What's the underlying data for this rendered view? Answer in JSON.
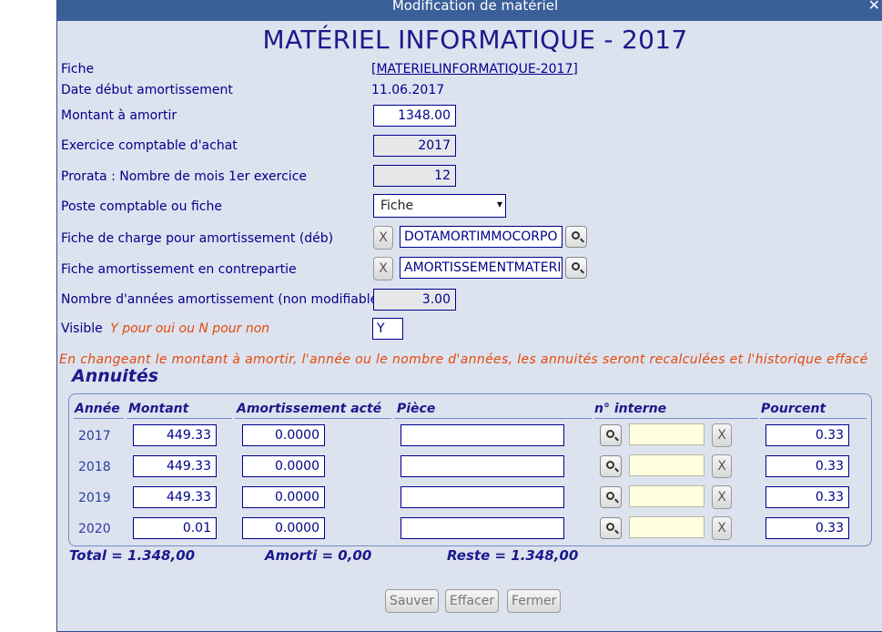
{
  "dialog": {
    "window_title": "Modification de matériel",
    "close_glyph": "✕",
    "heading": "MATÉRIEL INFORMATIQUE - 2017"
  },
  "form": {
    "fiche": {
      "label": "Fiche",
      "value": "[MATERIELINFORMATIQUE-2017]"
    },
    "date_debut": {
      "label": "Date début amortissement",
      "value": "11.06.2017"
    },
    "montant": {
      "label": "Montant à amortir",
      "value": "1348.00"
    },
    "exercice": {
      "label": "Exercice comptable d'achat",
      "value": "2017"
    },
    "prorata": {
      "label": "Prorata : Nombre de mois 1er exercice",
      "value": "12"
    },
    "poste": {
      "label": "Poste comptable ou fiche",
      "value": "Fiche"
    },
    "fiche_charge": {
      "label": "Fiche de charge pour amortissement (déb)",
      "value": "DOTAMORTIMMOCORPO",
      "clear_label": "X"
    },
    "fiche_contrepartie": {
      "label": "Fiche amortissement en contrepartie",
      "value": "AMORTISSEMENTMATERIEL",
      "clear_label": "X"
    },
    "nb_annees": {
      "label": "Nombre d'années amortissement (non modifiable)",
      "value": "3.00"
    },
    "visible": {
      "label": "Visible",
      "hint": "Y pour oui ou N pour non",
      "value": "Y"
    }
  },
  "warning": "En changeant le montant à amortir, l'année ou le nombre d'années, les annuités seront recalculées et l'historique effacé",
  "annuites": {
    "title": "Annuités",
    "headers": {
      "annee": "Année",
      "montant": "Montant",
      "amort": "Amortissement acté",
      "piece": "Pièce",
      "interne": "n° interne",
      "pourcent": "Pourcent"
    },
    "rows": [
      {
        "annee": "2017",
        "montant": "449.33",
        "amort": "0.0000",
        "piece": "",
        "pourcent": "0.33",
        "clear_label": "X"
      },
      {
        "annee": "2018",
        "montant": "449.33",
        "amort": "0.0000",
        "piece": "",
        "pourcent": "0.33",
        "clear_label": "X"
      },
      {
        "annee": "2019",
        "montant": "449.33",
        "amort": "0.0000",
        "piece": "",
        "pourcent": "0.33",
        "clear_label": "X"
      },
      {
        "annee": "2020",
        "montant": "0.01",
        "amort": "0.0000",
        "piece": "",
        "pourcent": "0.33",
        "clear_label": "X"
      }
    ]
  },
  "totals": {
    "total": "Total = 1.348,00",
    "amorti": "Amorti = 0,00",
    "reste": "Reste = 1.348,00"
  },
  "buttons": {
    "save": "Sauver",
    "delete": "Effacer",
    "close": "Fermer"
  }
}
